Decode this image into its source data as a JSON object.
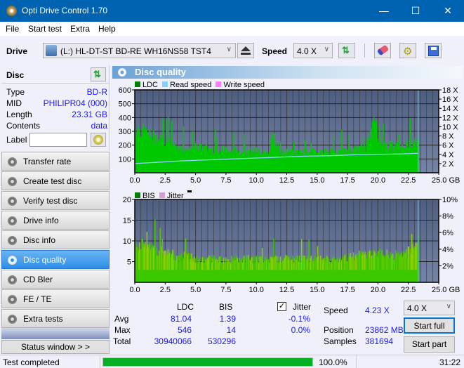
{
  "window": {
    "title": "Opti Drive Control 1.70",
    "controls": [
      "minimize",
      "maximize",
      "close"
    ]
  },
  "menu": [
    "File",
    "Start test",
    "Extra",
    "Help"
  ],
  "toolbar": {
    "drive_label": "Drive",
    "drive_value": "(L:)  HL-DT-ST BD-RE  WH16NS58 TST4",
    "speed_label": "Speed",
    "speed_value": "4.0 X"
  },
  "disc": {
    "header": "Disc",
    "rows": [
      {
        "label": "Type",
        "value": "BD-R"
      },
      {
        "label": "MID",
        "value": "PHILIPR04 (000)"
      },
      {
        "label": "Length",
        "value": "23.31 GB"
      },
      {
        "label": "Contents",
        "value": "data"
      }
    ],
    "label_field_label": "Label",
    "label_field_value": ""
  },
  "nav": [
    {
      "label": "Transfer rate",
      "active": false
    },
    {
      "label": "Create test disc",
      "active": false
    },
    {
      "label": "Verify test disc",
      "active": false
    },
    {
      "label": "Drive info",
      "active": false
    },
    {
      "label": "Disc info",
      "active": false
    },
    {
      "label": "Disc quality",
      "active": true
    },
    {
      "label": "CD Bler",
      "active": false
    },
    {
      "label": "FE / TE",
      "active": false
    },
    {
      "label": "Extra tests",
      "active": false
    }
  ],
  "status_window_button": "Status window > >",
  "panel": {
    "title": "Disc quality"
  },
  "chart_data": [
    {
      "type": "area",
      "title": "LDC chart",
      "legend": [
        {
          "name": "LDC",
          "color": "#008000"
        },
        {
          "name": "Read speed",
          "color": "#87cefa"
        },
        {
          "name": "Write speed",
          "color": "#ff80ff"
        }
      ],
      "legend_placement": "top-left",
      "xlabel": "GB",
      "x_ticks": [
        "0.0",
        "2.5",
        "5.0",
        "7.5",
        "10.0",
        "12.5",
        "15.0",
        "17.5",
        "20.0",
        "22.5",
        "25.0 GB"
      ],
      "xlim": [
        0,
        25
      ],
      "y_ticks_left": [
        "100",
        "200",
        "300",
        "400",
        "500",
        "600"
      ],
      "ylim_left": [
        0,
        600
      ],
      "y_ticks_right": [
        "2 X",
        "4 X",
        "6 X",
        "8 X",
        "10 X",
        "12 X",
        "14 X",
        "16 X",
        "18 X"
      ],
      "ylim_right": [
        0,
        18
      ],
      "grid": true,
      "series": [
        {
          "name": "LDC (approx envelope)",
          "x": [
            0,
            0.5,
            1,
            1.5,
            2,
            2.5,
            3,
            3.3,
            4,
            5,
            6,
            7,
            8,
            9,
            10,
            11,
            11.3,
            12,
            13,
            14,
            15,
            16,
            17,
            18,
            19,
            19.8,
            20,
            21,
            22,
            22.5,
            23.3
          ],
          "values": [
            350,
            330,
            300,
            280,
            260,
            250,
            240,
            180,
            190,
            200,
            190,
            180,
            175,
            170,
            170,
            165,
            290,
            160,
            160,
            160,
            165,
            170,
            175,
            180,
            200,
            420,
            220,
            210,
            210,
            230,
            240
          ]
        },
        {
          "name": "Read speed",
          "x": [
            0,
            2,
            4,
            6,
            8,
            10,
            12,
            14,
            16,
            18,
            20,
            22,
            23.3
          ],
          "values": [
            2.0,
            2.3,
            2.6,
            2.8,
            3.0,
            3.2,
            3.4,
            3.6,
            3.7,
            3.9,
            4.0,
            4.1,
            4.23
          ]
        }
      ],
      "marker_x": 23.31
    },
    {
      "type": "bar",
      "title": "BIS chart",
      "legend": [
        {
          "name": "BIS",
          "color": "#008000"
        },
        {
          "name": "Jitter",
          "color": "#d4a0d4"
        }
      ],
      "legend_placement": "top-left",
      "xlabel": "GB",
      "x_ticks": [
        "0.0",
        "2.5",
        "5.0",
        "7.5",
        "10.0",
        "12.5",
        "15.0",
        "17.5",
        "20.0",
        "22.5",
        "25.0 GB"
      ],
      "xlim": [
        0,
        25
      ],
      "y_ticks_left": [
        "5",
        "10",
        "15",
        "20"
      ],
      "ylim_left": [
        0,
        20
      ],
      "y_ticks_right": [
        "2%",
        "4%",
        "6%",
        "8%",
        "10%"
      ],
      "ylim_right": [
        0,
        10
      ],
      "grid": true,
      "series": [
        {
          "name": "BIS (approx envelope)",
          "x": [
            0,
            0.5,
            1,
            1.5,
            2,
            2.5,
            3,
            3.3,
            4,
            5,
            6,
            7,
            8,
            9,
            10,
            11,
            12,
            13,
            14,
            15,
            16,
            17,
            18,
            19,
            20,
            21,
            22,
            22.5,
            23.3
          ],
          "values": [
            10,
            10,
            9,
            9,
            8,
            8,
            8,
            6,
            7,
            6,
            6,
            6,
            6,
            6,
            6,
            6,
            6,
            6,
            6,
            6,
            6,
            6,
            7,
            7,
            8,
            7,
            7,
            8,
            9
          ]
        }
      ],
      "marker_x": 23.31
    }
  ],
  "stats": {
    "col_ldc": "LDC",
    "col_bis": "BIS",
    "rows": [
      {
        "label": "Avg",
        "ldc": "81.04",
        "bis": "1.39",
        "jitter": "-0.1%"
      },
      {
        "label": "Max",
        "ldc": "546",
        "bis": "14",
        "jitter": "0.0%"
      },
      {
        "label": "Total",
        "ldc": "30940066",
        "bis": "530296"
      }
    ],
    "jitter_label": "Jitter",
    "jitter_checked": true,
    "speed_label": "Speed",
    "speed_value": "4.23 X",
    "position_label": "Position",
    "position_value": "23862 MB",
    "samples_label": "Samples",
    "samples_value": "381694",
    "speed_select": "4.0 X",
    "start_full": "Start full",
    "start_part": "Start part"
  },
  "status": {
    "text": "Test completed",
    "progress_percent": 100.0,
    "progress_label": "100.0%",
    "elapsed": "31:22"
  },
  "colors": {
    "titlebar": "#0063b1",
    "accent_active": "#2d8ee6",
    "plot_bg": "#5a6a8c",
    "ldc": "#00c800",
    "bis": "#66cc00",
    "read_speed": "#87cefa",
    "progress": "#00b020"
  }
}
